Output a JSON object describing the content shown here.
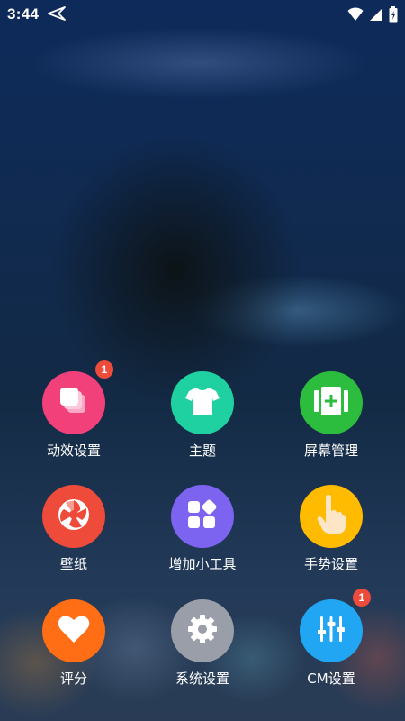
{
  "status_bar": {
    "time": "3:44",
    "icons": [
      "navigation-arrow-icon",
      "wifi-icon",
      "cellular-signal-icon",
      "battery-charging-icon"
    ]
  },
  "apps": [
    {
      "label": "动效设置",
      "icon": "cards-stack-icon",
      "color": "#f2407a",
      "badge": "1"
    },
    {
      "label": "主题",
      "icon": "tshirt-icon",
      "color": "#1fd1a1"
    },
    {
      "label": "屏幕管理",
      "icon": "screen-add-icon",
      "color": "#2dbd3e"
    },
    {
      "label": "壁纸",
      "icon": "aperture-icon",
      "color": "#ee4b3b"
    },
    {
      "label": "增加小工具",
      "icon": "widgets-icon",
      "color": "#7c63f0"
    },
    {
      "label": "手势设置",
      "icon": "pointing-hand-icon",
      "color": "#ffbb00"
    },
    {
      "label": "评分",
      "icon": "heart-icon",
      "color": "#ff6d14"
    },
    {
      "label": "系统设置",
      "icon": "gear-icon",
      "color": "#9a9ea8"
    },
    {
      "label": "CM设置",
      "icon": "equalizer-sliders-icon",
      "color": "#21a6f3",
      "badge": "1"
    }
  ]
}
